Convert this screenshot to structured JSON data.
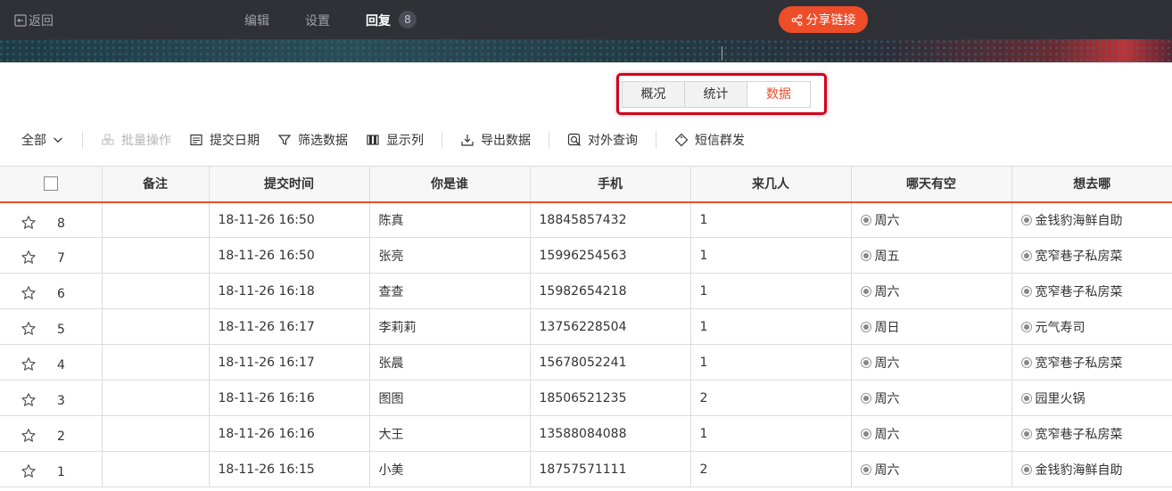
{
  "topbar": {
    "back_label": "返回",
    "nav": [
      "编辑",
      "设置",
      "回复"
    ],
    "reply_count": "8",
    "share_label": "分享链接",
    "accent": "#ee4d2a"
  },
  "tabs": {
    "items": [
      "概况",
      "统计",
      "数据"
    ],
    "active": "数据"
  },
  "toolbar": {
    "filter_all": "全部",
    "batch": "批量操作",
    "submit_date": "提交日期",
    "filter_data": "筛选数据",
    "show_columns": "显示列",
    "export": "导出数据",
    "external_query": "对外查询",
    "sms": "短信群发"
  },
  "table": {
    "headers": [
      "备注",
      "提交时间",
      "你是谁",
      "手机",
      "来几人",
      "哪天有空",
      "想去哪"
    ],
    "rows": [
      {
        "num": "8",
        "note": "",
        "time": "18-11-26 16:50",
        "who": "陈真",
        "phone": "18845857432",
        "count": "1",
        "day": "周六",
        "place": "金钱豹海鲜自助"
      },
      {
        "num": "7",
        "note": "",
        "time": "18-11-26 16:50",
        "who": "张亮",
        "phone": "15996254563",
        "count": "1",
        "day": "周五",
        "place": "宽窄巷子私房菜"
      },
      {
        "num": "6",
        "note": "",
        "time": "18-11-26 16:18",
        "who": "查查",
        "phone": "15982654218",
        "count": "1",
        "day": "周六",
        "place": "宽窄巷子私房菜"
      },
      {
        "num": "5",
        "note": "",
        "time": "18-11-26 16:17",
        "who": "李莉莉",
        "phone": "13756228504",
        "count": "1",
        "day": "周日",
        "place": "元气寿司"
      },
      {
        "num": "4",
        "note": "",
        "time": "18-11-26 16:17",
        "who": "张晨",
        "phone": "15678052241",
        "count": "1",
        "day": "周六",
        "place": "宽窄巷子私房菜"
      },
      {
        "num": "3",
        "note": "",
        "time": "18-11-26 16:16",
        "who": "图图",
        "phone": "18506521235",
        "count": "2",
        "day": "周六",
        "place": "园里火锅"
      },
      {
        "num": "2",
        "note": "",
        "time": "18-11-26 16:16",
        "who": "大王",
        "phone": "13588084088",
        "count": "1",
        "day": "周六",
        "place": "宽窄巷子私房菜"
      },
      {
        "num": "1",
        "note": "",
        "time": "18-11-26 16:15",
        "who": "小美",
        "phone": "18757571111",
        "count": "2",
        "day": "周六",
        "place": "金钱豹海鲜自助"
      }
    ]
  }
}
